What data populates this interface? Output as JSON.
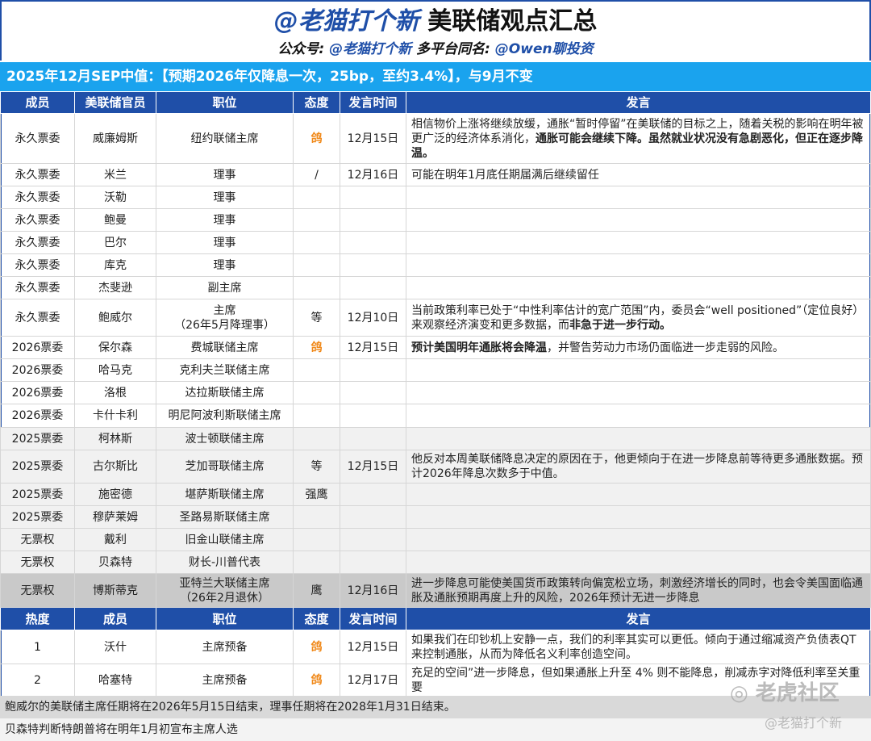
{
  "header": {
    "title_handle": "@老猫打个新",
    "title_main": " 美联储观点汇总",
    "sub_label1": "公众号: ",
    "sub_handle1": "@老猫打个新",
    "sub_label2": "  多平台同名: ",
    "sub_handle2": "@Owen聊投资"
  },
  "banner": "2025年12月SEP中值：【预期2026年仅降息一次，25bp，至约3.4%】，与9月不变",
  "columns": [
    "成员",
    "美联储官员",
    "职位",
    "态度",
    "发言时间",
    "发言"
  ],
  "rows": [
    {
      "member": "永久票委",
      "name": "威廉姆斯",
      "role": "纽约联储主席",
      "stance": "鸽",
      "date": "12月15日",
      "speech": "相信物价上涨将继续放缓，通胀“暂时停留”在美联储的目标之上，随着关税的影响在明年被更广泛的经济体系消化，",
      "speech_bold": "通胀可能会继续下降。虽然就业状况没有急剧恶化，但正在逐步降温。"
    },
    {
      "member": "永久票委",
      "name": "米兰",
      "role": "理事",
      "stance": "/",
      "date": "12月16日",
      "speech": "可能在明年1月底任期届满后继续留任"
    },
    {
      "member": "永久票委",
      "name": "沃勒",
      "role": "理事"
    },
    {
      "member": "永久票委",
      "name": "鲍曼",
      "role": "理事"
    },
    {
      "member": "永久票委",
      "name": "巴尔",
      "role": "理事"
    },
    {
      "member": "永久票委",
      "name": "库克",
      "role": "理事"
    },
    {
      "member": "永久票委",
      "name": "杰斐逊",
      "role": "副主席"
    },
    {
      "member": "永久票委",
      "name": "鲍威尔",
      "role": "主席",
      "role2": "（26年5月降理事）",
      "stance": "等",
      "date": "12月10日",
      "speech": "当前政策利率已处于“中性利率估计的宽广范围”内，委员会“well positioned”（定位良好）来观察经济演变和更多数据，而",
      "speech_bold": "非急于进一步行动。"
    },
    {
      "member": "2026票委",
      "name": "保尔森",
      "role": "费城联储主席",
      "stance": "鸽",
      "date": "12月15日",
      "speech_bold_first": "预计美国明年通胀将会降温",
      "speech": "，并警告劳动力市场仍面临进一步走弱的风险。"
    },
    {
      "member": "2026票委",
      "name": "哈马克",
      "role": "克利夫兰联储主席"
    },
    {
      "member": "2026票委",
      "name": "洛根",
      "role": "达拉斯联储主席"
    },
    {
      "member": "2026票委",
      "name": "卡什卡利",
      "role": "明尼阿波利斯联储主席"
    },
    {
      "member": "2025票委",
      "name": "柯林斯",
      "role": "波士顿联储主席"
    },
    {
      "member": "2025票委",
      "name": "古尔斯比",
      "role": "芝加哥联储主席",
      "stance": "等",
      "date": "12月15日",
      "speech": "他反对本周美联储降息决定的原因在于，他更倾向于在进一步降息前等待更多通胀数据。预计2026年降息次数多于中值。"
    },
    {
      "member": "2025票委",
      "name": "施密德",
      "role": "堪萨斯联储主席",
      "stance": "强鹰"
    },
    {
      "member": "2025票委",
      "name": "穆萨莱姆",
      "role": "圣路易斯联储主席"
    },
    {
      "member": "无票权",
      "name": "戴利",
      "role": "旧金山联储主席"
    },
    {
      "member": "无票权",
      "name": "贝森特",
      "role": "财长-川普代表"
    },
    {
      "member": "无票权",
      "name": "博斯蒂克",
      "role": "亚特兰大联储主席",
      "role2": "（26年2月退休）",
      "stance": "鹰",
      "date": "12月16日",
      "speech": "进一步降息可能使美国货币政策转向偏宽松立场，刺激经济增长的同时，也会令美国面临通胀及通胀预期再度上升的风险，2026年预计无进一步降息"
    }
  ],
  "columns2": [
    "热度",
    "成员",
    "职位",
    "态度",
    "发言时间",
    "发言"
  ],
  "rows2": [
    {
      "rank": "1",
      "name": "沃什",
      "role": "主席预备",
      "stance": "鸽",
      "date": "12月15日",
      "speech": "如果我们在印钞机上安静一点，我们的利率其实可以更低。倾向于通过缩减资产负债表QT来控制通胀，从而为降低名义利率创造空间。"
    },
    {
      "rank": "2",
      "name": "哈塞特",
      "role": "主席预备",
      "stance": "鸽",
      "date": "12月17日",
      "speech": "充足的空间”进一步降息，但如果通胀上升至 4% 则不能降息，削减赤字对降低利率至关重要"
    }
  ],
  "footer": [
    "鲍威尔的美联储主席任期将在2026年5月15日结束，理事任期将在2028年1月31日结束。",
    "贝森特判断特朗普将在明年1月初宣布主席人选"
  ],
  "watermark": [
    "老虎社区",
    "@老猫打个新"
  ],
  "colors": {
    "header": "#1f4fa8",
    "banner": "#1aa3ee",
    "dove": "#f08a1c"
  }
}
